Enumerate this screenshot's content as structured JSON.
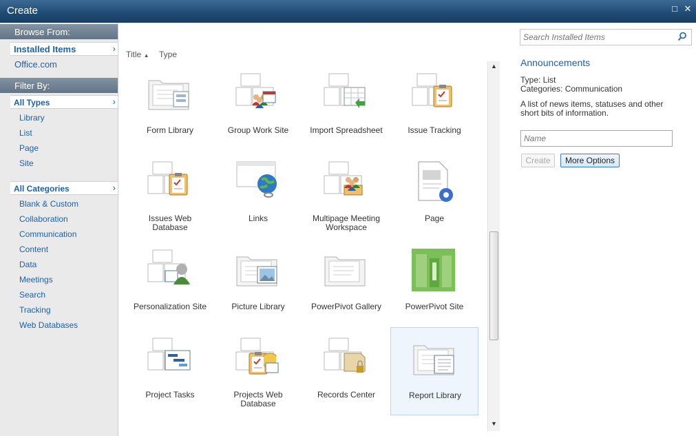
{
  "window": {
    "title": "Create",
    "maximize_glyph": "□",
    "close_glyph": "✕"
  },
  "left": {
    "browse_header": "Browse From:",
    "browse_selected": "Installed Items",
    "browse_other": "Office.com",
    "filter_header": "Filter By:",
    "types_selected": "All Types",
    "types": [
      "Library",
      "List",
      "Page",
      "Site"
    ],
    "categories_selected": "All Categories",
    "categories": [
      "Blank & Custom",
      "Collaboration",
      "Communication",
      "Content",
      "Data",
      "Meetings",
      "Search",
      "Tracking",
      "Web Databases"
    ]
  },
  "sort": {
    "title": "Title",
    "type": "Type"
  },
  "tiles": [
    {
      "label": "Form Library",
      "icon": "form-library-icon"
    },
    {
      "label": "Group Work Site",
      "icon": "group-work-site-icon"
    },
    {
      "label": "Import Spreadsheet",
      "icon": "import-spreadsheet-icon"
    },
    {
      "label": "Issue Tracking",
      "icon": "issue-tracking-icon"
    },
    {
      "label": "Issues Web\nDatabase",
      "icon": "issues-web-database-icon"
    },
    {
      "label": "Links",
      "icon": "links-globe-icon"
    },
    {
      "label": "Multipage Meeting\nWorkspace",
      "icon": "meeting-workspace-icon"
    },
    {
      "label": "Page",
      "icon": "page-icon"
    },
    {
      "label": "Personalization Site",
      "icon": "personalization-site-icon"
    },
    {
      "label": "Picture Library",
      "icon": "picture-library-icon"
    },
    {
      "label": "PowerPivot Gallery",
      "icon": "powerpivot-gallery-icon"
    },
    {
      "label": "PowerPivot Site",
      "icon": "powerpivot-site-icon"
    },
    {
      "label": "Project Tasks",
      "icon": "project-tasks-icon"
    },
    {
      "label": "Projects Web\nDatabase",
      "icon": "projects-web-database-icon"
    },
    {
      "label": "Records Center",
      "icon": "records-center-icon"
    },
    {
      "label": "Report Library",
      "icon": "report-library-icon"
    }
  ],
  "selected_tile": "Report Library",
  "right": {
    "search_placeholder": "Search Installed Items",
    "title": "Announcements",
    "type_line": "Type: List",
    "categories_line": "Categories: Communication",
    "description_line1": "A list of news items, statuses and other",
    "description_line2": "short bits of information.",
    "name_placeholder": "Name",
    "create_label": "Create",
    "more_options_label": "More Options"
  },
  "colors": {
    "link": "#1b62a8",
    "titlebar": "#1e4a73",
    "nav_header": "#6f8091",
    "selected_tile": "#eef5fc"
  }
}
